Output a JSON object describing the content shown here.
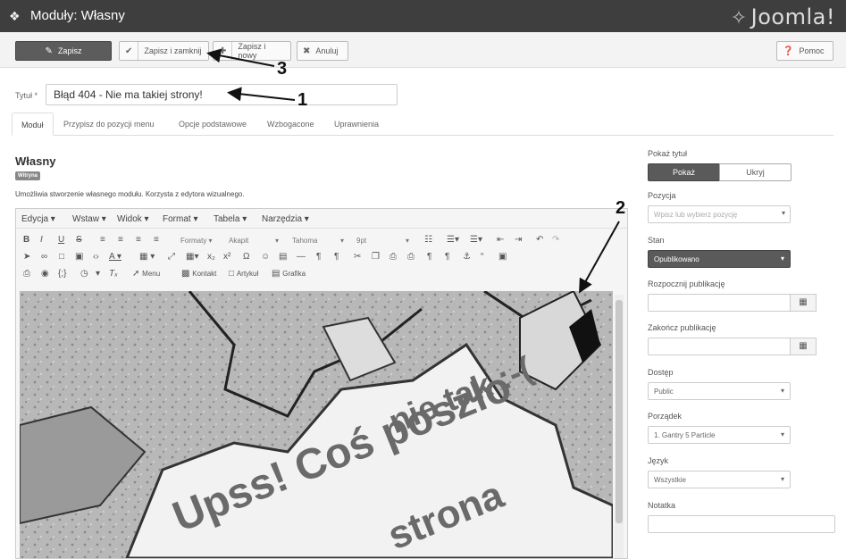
{
  "header": {
    "title": "Moduły: Własny",
    "logo_text": "Joomla!"
  },
  "toolbar": {
    "save": "Zapisz",
    "save_close": "Zapisz i zamknij",
    "save_new": "Zapisz i nowy",
    "cancel": "Anuluj",
    "help": "Pomoc"
  },
  "form": {
    "title_label": "Tytuł *",
    "title_value": "Błąd 404 - Nie ma takiej strony!"
  },
  "tabs": [
    "Moduł",
    "Przypisz do pozycji menu",
    "Opcje podstawowe",
    "Wzbogacone",
    "Uprawnienia"
  ],
  "module": {
    "name": "Własny",
    "badge": "Witryna",
    "description": "Umożliwia stworzenie własnego modułu. Korzysta z edytora wizualnego."
  },
  "editor": {
    "menu": [
      "Edycja ▾",
      "Wstaw ▾",
      "Widok ▾",
      "Format ▾",
      "Tabela ▾",
      "Narzędzia ▾"
    ],
    "formats": "Formaty ▾",
    "paragraph": "Akapit",
    "font": "Tahoma",
    "size": "9pt",
    "btn_menu": "Menu",
    "btn_contact": "Kontakt",
    "btn_article": "Artykuł",
    "btn_image": "Grafika",
    "image_text_1": "Upss! Coś poszło",
    "image_text_2": "nie tak :-(",
    "image_text_3": "strona"
  },
  "sidebar": {
    "show_title_label": "Pokaż tytuł",
    "show": "Pokaż",
    "hide": "Ukryj",
    "position_label": "Pozycja",
    "position_placeholder": "Wpisz lub wybierz pozycję",
    "state_label": "Stan",
    "state_value": "Opublikowano",
    "start_label": "Rozpocznij publikację",
    "finish_label": "Zakończ publikację",
    "access_label": "Dostęp",
    "access_value": "Public",
    "order_label": "Porządek",
    "order_value": "1. Gantry 5 Particle",
    "language_label": "Język",
    "language_value": "Wszystkie",
    "note_label": "Notatka"
  },
  "annotations": [
    "1",
    "2",
    "3"
  ]
}
